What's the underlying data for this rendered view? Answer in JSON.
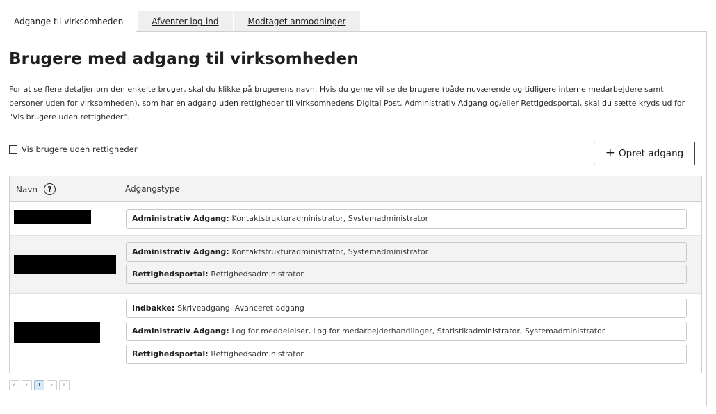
{
  "tabs": [
    {
      "label": "Adgange til virksomheden",
      "active": true
    },
    {
      "label": "Afventer log-ind",
      "active": false
    },
    {
      "label": "Modtaget anmodninger",
      "active": false
    }
  ],
  "page": {
    "title": "Brugere med adgang til virksomheden",
    "intro": "For at se flere detaljer om den enkelte bruger, skal du klikke på brugerens navn. Hvis du gerne vil se de brugere (både nuværende og tidligere interne medarbejdere samt personer uden for virksomheden), som har en adgang uden rettigheder til virksomhedens Digital Post, Administrativ Adgang og/eller Rettigedsportal, skal du sætte kryds ud for \"Vis brugere uden rettigheder\".",
    "checkbox_label": "Vis brugere uden rettigheder",
    "checkbox_checked": false,
    "create_button_label": "Opret adgang"
  },
  "table": {
    "columns": [
      "Navn",
      "Adgangstype"
    ],
    "rows": [
      {
        "name": "[redacted]",
        "access": [
          {
            "label": "Administrativ Adgang:",
            "value": "Kontaktstrukturadministrator, Systemadministrator"
          }
        ]
      },
      {
        "name": "[redacted]",
        "access": [
          {
            "label": "Administrativ Adgang:",
            "value": "Kontaktstrukturadministrator, Systemadministrator"
          },
          {
            "label": "Rettighedsportal:",
            "value": "Rettighedsadministrator"
          }
        ]
      },
      {
        "name": "[redacted]",
        "access": [
          {
            "label": "Indbakke:",
            "value": "Skriveadgang, Avanceret adgang"
          },
          {
            "label": "Administrativ Adgang:",
            "value": "Log for meddelelser, Log for medarbejderhandlinger, Statistikadministrator, Systemadministrator"
          },
          {
            "label": "Rettighedsportal:",
            "value": "Rettighedsadministrator"
          }
        ]
      }
    ]
  },
  "pagination": {
    "first": "«",
    "prev": "‹",
    "current": "1",
    "next": "›",
    "last": "»"
  },
  "icons": {
    "help": "question-circle-icon",
    "add": "plus-icon"
  },
  "colors": {
    "header_bg": "#f3f3f3",
    "border": "#cfcfcf",
    "current_page_bg": "#d9e8f6"
  }
}
